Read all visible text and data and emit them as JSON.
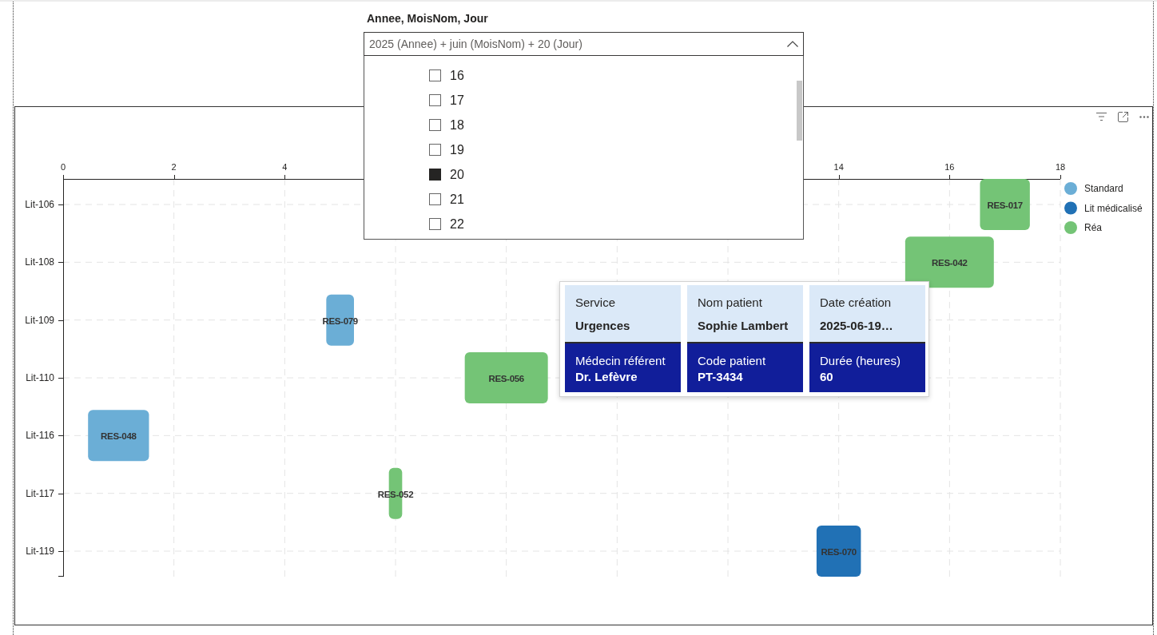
{
  "slicer": {
    "title": "Annee, MoisNom, Jour",
    "value": "2025 (Annee) + juin (MoisNom) + 20 (Jour)",
    "expanded": true,
    "options": [
      {
        "label": "16",
        "checked": false
      },
      {
        "label": "17",
        "checked": false
      },
      {
        "label": "18",
        "checked": false
      },
      {
        "label": "19",
        "checked": false
      },
      {
        "label": "20",
        "checked": true
      },
      {
        "label": "21",
        "checked": false
      },
      {
        "label": "22",
        "checked": false
      }
    ]
  },
  "chart": {
    "chart_data": {
      "type": "bar",
      "orientation": "horizontal",
      "grid": true,
      "legend": "right",
      "categories": [
        "Lit-106",
        "Lit-108",
        "Lit-109",
        "Lit-110",
        "Lit-116",
        "Lit-117",
        "Lit-119"
      ],
      "xlim": [
        0,
        18
      ],
      "xticks": [
        0,
        2,
        4,
        14,
        16,
        18
      ],
      "series": [
        {
          "name": "Standard",
          "color": "#6baed6",
          "base": [
            null,
            null,
            4.75,
            null,
            0.45,
            null,
            null
          ],
          "values": [
            null,
            null,
            0.5,
            null,
            1.1,
            null,
            null
          ],
          "value_labels": [
            null,
            null,
            "RES-079",
            null,
            "RES-048",
            null,
            null
          ]
        },
        {
          "name": "Lit médicalisé",
          "color": "#2171b5",
          "base": [
            null,
            null,
            null,
            null,
            null,
            null,
            13.6
          ],
          "values": [
            null,
            null,
            null,
            null,
            null,
            null,
            0.8
          ],
          "value_labels": [
            null,
            null,
            null,
            null,
            null,
            null,
            "RES-070"
          ]
        },
        {
          "name": "Réa",
          "color": "#74c476",
          "base": [
            16.55,
            15.2,
            null,
            7.25,
            null,
            5.88,
            null
          ],
          "values": [
            0.9,
            1.6,
            null,
            1.5,
            null,
            0.24,
            null
          ],
          "value_labels": [
            "RES-017",
            "RES-042",
            null,
            "RES-056",
            null,
            "RES-052",
            null
          ]
        }
      ]
    },
    "tooltip": {
      "top_row": [
        {
          "label": "Service",
          "value": "Urgences"
        },
        {
          "label": "Nom patient",
          "value": "Sophie Lambert"
        },
        {
          "label": "Date création",
          "value": "2025-06-19…"
        }
      ],
      "bottom_row": [
        {
          "label": "Médecin référent",
          "value": "Dr. Lefèvre"
        },
        {
          "label": "Code patient",
          "value": "PT-3434"
        },
        {
          "label": "Durée (heures)",
          "value": "60"
        }
      ]
    }
  }
}
